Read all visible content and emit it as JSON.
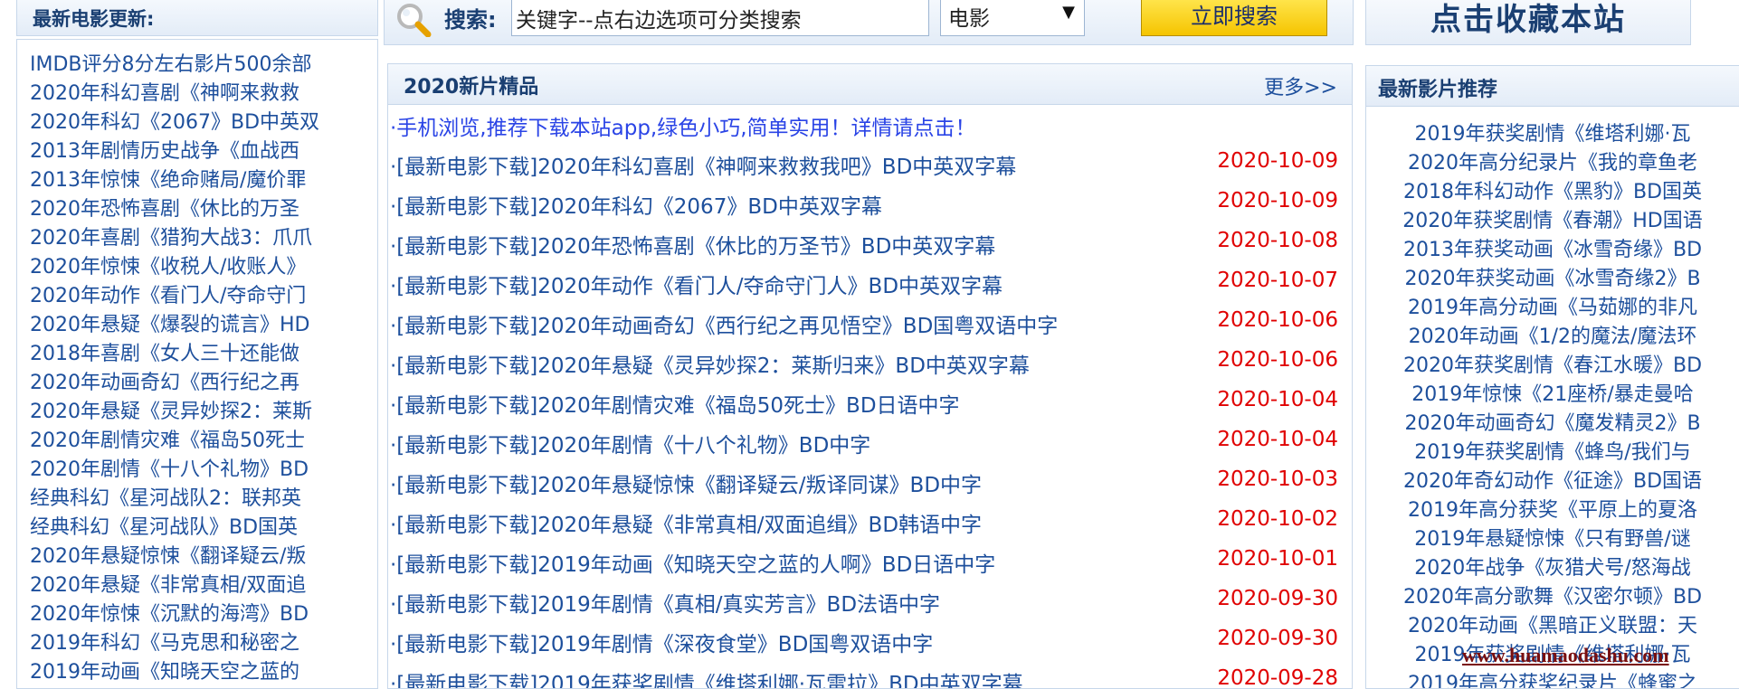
{
  "left": {
    "title": "最新电影更新:",
    "items": [
      "IMDB评分8分左右影片500余部",
      "2020年科幻喜剧《神啊来救救",
      "2020年科幻《2067》BD中英双",
      "2013年剧情历史战争《血战西",
      "2013年惊悚《绝命赌局/魔价罪",
      "2020年恐怖喜剧《休比的万圣",
      "2020年喜剧《猎狗大战3：爪爪",
      "2020年惊悚《收税人/收账人》",
      "2020年动作《看门人/夺命守门",
      "2020年悬疑《爆裂的谎言》HD",
      "2018年喜剧《女人三十还能做",
      "2020年动画奇幻《西行纪之再",
      "2020年悬疑《灵异妙探2：莱斯",
      "2020年剧情灾难《福岛50死士",
      "2020年剧情《十八个礼物》BD",
      "经典科幻《星河战队2：联邦英",
      "经典科幻《星河战队》BD国英",
      "2020年悬疑惊悚《翻译疑云/叛",
      "2020年悬疑《非常真相/双面追",
      "2020年惊悚《沉默的海湾》BD",
      "2019年科幻《马克思和秘密之",
      "2019年动画《知晓天空之蓝的"
    ]
  },
  "search": {
    "label": "搜索:",
    "value": "关键字--点右边选项可分类搜索",
    "category": "电影",
    "button": "立即搜索"
  },
  "bookmark": {
    "label": "点击收藏本站"
  },
  "center": {
    "title": "2020新片精品",
    "more": "更多>>",
    "notice": "·手机浏览,推荐下载本站app,绿色小巧,简单实用！详情请点击！",
    "rows": [
      {
        "title": "·[最新电影下载]2020年科幻喜剧《神啊来救救我吧》BD中英双字幕",
        "date": "2020-10-09"
      },
      {
        "title": "·[最新电影下载]2020年科幻《2067》BD中英双字幕",
        "date": "2020-10-09"
      },
      {
        "title": "·[最新电影下载]2020年恐怖喜剧《休比的万圣节》BD中英双字幕",
        "date": "2020-10-08"
      },
      {
        "title": "·[最新电影下载]2020年动作《看门人/夺命守门人》BD中英双字幕",
        "date": "2020-10-07"
      },
      {
        "title": "·[最新电影下载]2020年动画奇幻《西行纪之再见悟空》BD国粤双语中字",
        "date": "2020-10-06"
      },
      {
        "title": "·[最新电影下载]2020年悬疑《灵异妙探2：莱斯归来》BD中英双字幕",
        "date": "2020-10-06"
      },
      {
        "title": "·[最新电影下载]2020年剧情灾难《福岛50死士》BD日语中字",
        "date": "2020-10-04"
      },
      {
        "title": "·[最新电影下载]2020年剧情《十八个礼物》BD中字",
        "date": "2020-10-04"
      },
      {
        "title": "·[最新电影下载]2020年悬疑惊悚《翻译疑云/叛译同谋》BD中字",
        "date": "2020-10-03"
      },
      {
        "title": "·[最新电影下载]2020年悬疑《非常真相/双面追缉》BD韩语中字",
        "date": "2020-10-02"
      },
      {
        "title": "·[最新电影下载]2019年动画《知晓天空之蓝的人啊》BD日语中字",
        "date": "2020-10-01"
      },
      {
        "title": "·[最新电影下载]2019年剧情《真相/真实芳言》BD法语中字",
        "date": "2020-09-30"
      },
      {
        "title": "·[最新电影下载]2019年剧情《深夜食堂》BD国粤双语中字",
        "date": "2020-09-30"
      },
      {
        "title": "·[最新电影下载]2019年获奖剧情《维塔利娜·瓦雷拉》BD中英双字幕",
        "date": "2020-09-28"
      }
    ]
  },
  "right": {
    "title": "最新影片推荐",
    "items": [
      "2019年获奖剧情《维塔利娜·瓦",
      "2020年高分纪录片《我的章鱼老",
      "2018年科幻动作《黑豹》BD国英",
      "2020年获奖剧情《春潮》HD国语",
      "2013年获奖动画《冰雪奇缘》BD",
      "2020年获奖动画《冰雪奇缘2》B",
      "2019年高分动画《马茹娜的非凡",
      "2020年动画《1/2的魔法/魔法环",
      "2020年获奖剧情《春江水暖》BD",
      "2019年惊悚《21座桥/暴走曼哈",
      "2020年动画奇幻《魔发精灵2》B",
      "2019年获奖剧情《蜂鸟/我们与",
      "2020年奇幻动作《征途》BD国语",
      "2019年高分获奖《平原上的夏洛",
      "2019年悬疑惊悚《只有野兽/谜",
      "2020年战争《灰猎犬号/怒海战",
      "2020年高分歌舞《汉密尔顿》BD",
      "2020年动画《黑暗正义联盟：天",
      "2019年获奖剧情《维塔利娜·瓦",
      "2019年高分获奖纪录片《蜂蜜之"
    ]
  },
  "watermark": "www.huamaodashu.com"
}
